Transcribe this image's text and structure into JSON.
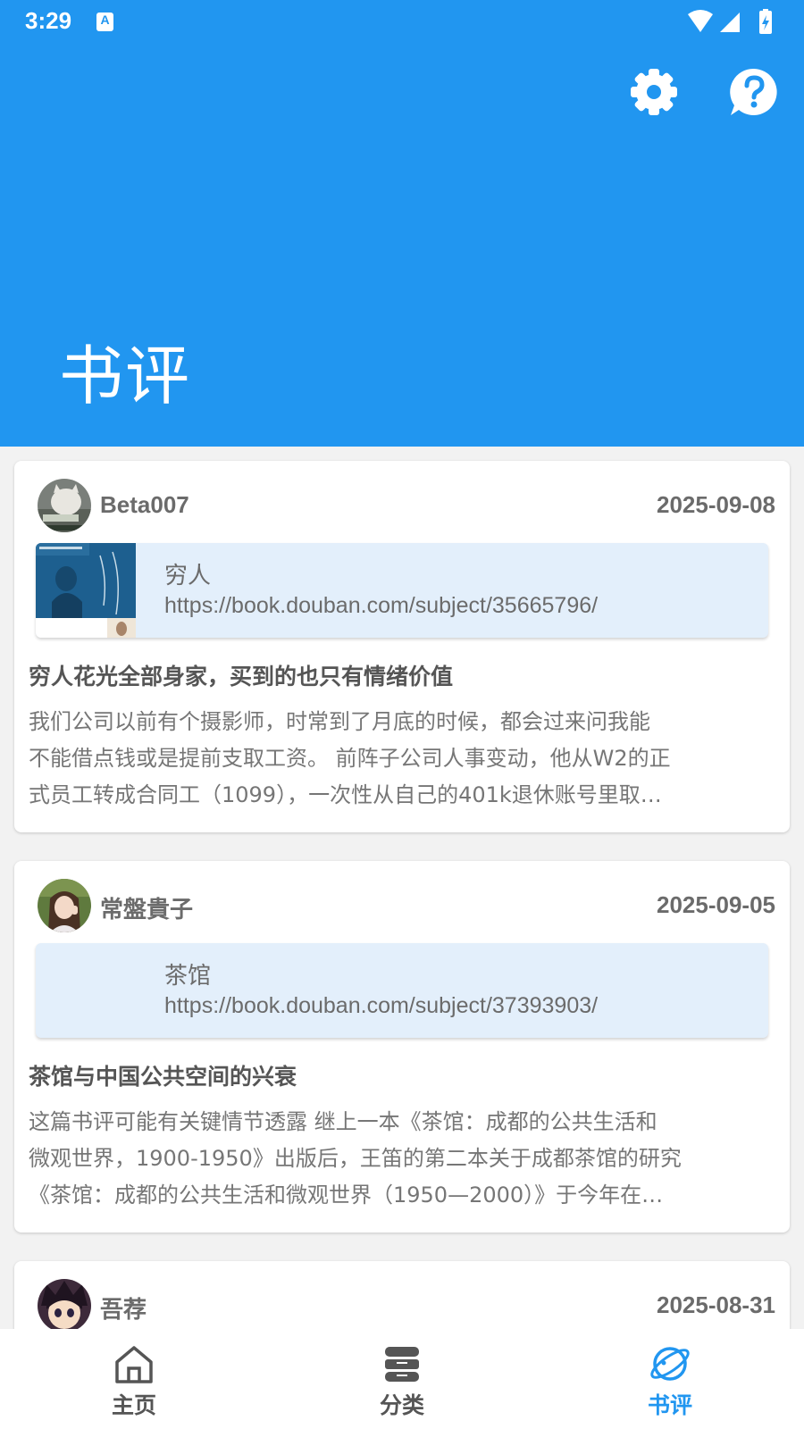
{
  "status_bar": {
    "time": "3:29",
    "notification_icon_letter": "A"
  },
  "header": {
    "title": "书评",
    "background_color": "#2196f0",
    "icons": [
      "settings-icon",
      "help-icon"
    ]
  },
  "reviews": [
    {
      "username": "Beta007",
      "date": "2025-09-08",
      "book_title": "穷人",
      "book_url": "https://book.douban.com/subject/35665796/",
      "review_title": "穷人花光全部身家，买到的也只有情绪价值",
      "review_lines": [
        "我们公司以前有个摄影师，时常到了月底的时候，都会过来问我能",
        "不能借点钱或是提前支取工资。 前阵子公司人事变动，他从W2的正",
        "式员工转成合同工（1099），一次性从自己的401k退休账号里取…"
      ]
    },
    {
      "username": "常盤貴子",
      "date": "2025-09-05",
      "book_title": "茶馆",
      "book_url": "https://book.douban.com/subject/37393903/",
      "review_title": "茶馆与中国公共空间的兴衰",
      "review_lines": [
        "这篇书评可能有关键情节透露 继上一本《茶馆：成都的公共生活和",
        "微观世界，1900-1950》出版后，王笛的第二本关于成都茶馆的研究",
        "《茶馆：成都的公共生活和微观世界（1950—2000）》于今年在…"
      ]
    },
    {
      "username": "吾荐",
      "date": "2025-08-31"
    }
  ],
  "bottom_nav": {
    "items": [
      {
        "label": "主页",
        "icon": "home-icon",
        "active": false
      },
      {
        "label": "分类",
        "icon": "category-stack-icon",
        "active": false
      },
      {
        "label": "书评",
        "icon": "planet-icon",
        "active": true
      }
    ],
    "active_color": "#2196f0",
    "inactive_color": "#555555"
  }
}
